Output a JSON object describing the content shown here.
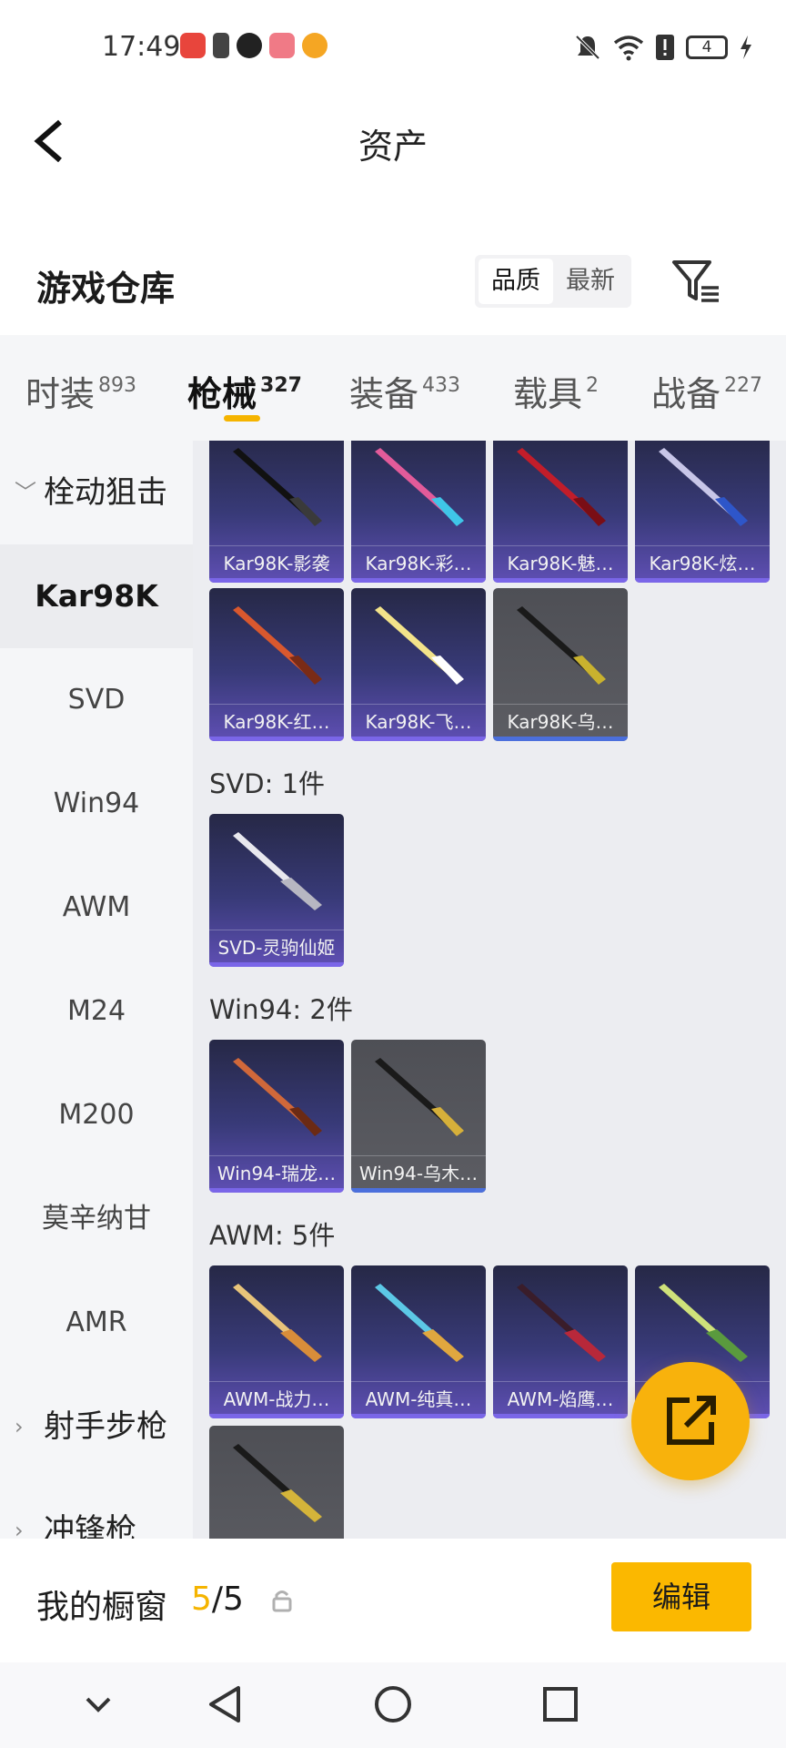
{
  "status_bar": {
    "time": "17:49",
    "battery": "4"
  },
  "header": {
    "title": "资产"
  },
  "warehouse": {
    "title": "游戏仓库",
    "sort_options": [
      "品质",
      "最新"
    ],
    "active_sort": "品质"
  },
  "tabs": [
    {
      "label": "时装",
      "count": "893"
    },
    {
      "label": "枪械",
      "count": "327"
    },
    {
      "label": "装备",
      "count": "433"
    },
    {
      "label": "载具",
      "count": "2"
    },
    {
      "label": "战备",
      "count": "227"
    }
  ],
  "sidebar": {
    "group1": "栓动狙击",
    "items": [
      "Kar98K",
      "SVD",
      "Win94",
      "AWM",
      "M24",
      "M200",
      "莫辛纳甘",
      "AMR"
    ],
    "group2": "射手步枪",
    "group3": "冲锋枪"
  },
  "content": {
    "kar98k_items": [
      "Kar98K-影袭",
      "Kar98K-彩…",
      "Kar98K-魅…",
      "Kar98K-炫…",
      "Kar98K-红…",
      "Kar98K-飞…",
      "Kar98K-乌…"
    ],
    "svd": {
      "header": "SVD: 1件",
      "items": [
        "SVD-灵驹仙姬"
      ]
    },
    "win94": {
      "header": "Win94: 2件",
      "items": [
        "Win94-瑞龙…",
        "Win94-乌木…"
      ]
    },
    "awm": {
      "header": "AWM: 5件",
      "items": [
        "AWM-战力…",
        "AWM-纯真…",
        "AWM-焰鹰…"
      ]
    }
  },
  "showcase": {
    "label": "我的橱窗",
    "current": "5",
    "separator": "/",
    "total": "5",
    "edit_label": "编辑"
  },
  "colors": {
    "accent": "#f5b400",
    "card_purple": "#383a78",
    "card_grey": "#56575d"
  }
}
